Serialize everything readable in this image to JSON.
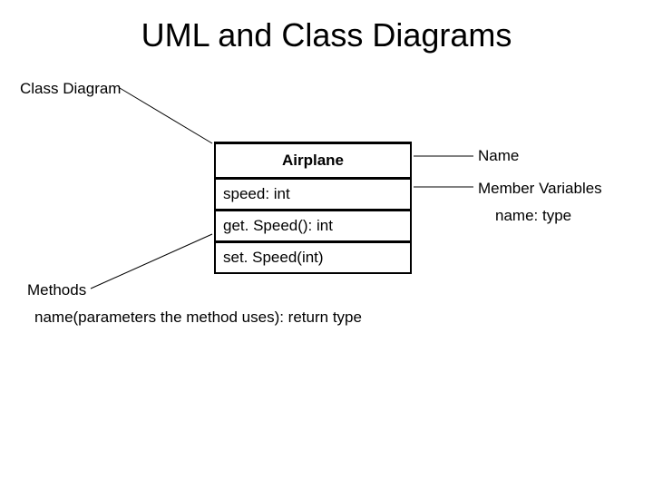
{
  "slide": {
    "title": "UML and Class Diagrams"
  },
  "labels": {
    "class_diagram": "Class Diagram",
    "name": "Name",
    "member_variables": "Member Variables",
    "name_type": "name: type",
    "methods": "Methods",
    "method_syntax": "name(parameters the method uses): return type"
  },
  "uml": {
    "class_name": "Airplane",
    "attribute": "speed: int",
    "method1": "get. Speed(): int",
    "method2": "set. Speed(int)"
  }
}
